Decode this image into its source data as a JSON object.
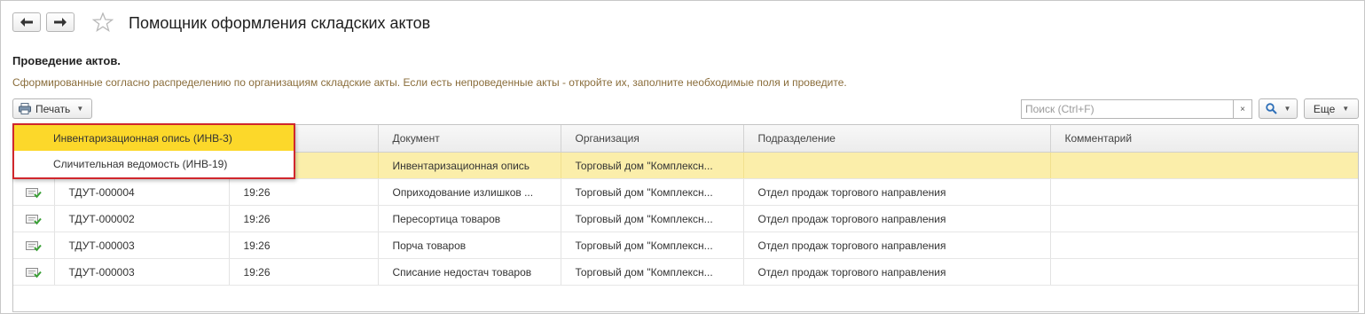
{
  "window": {
    "title": "Помощник оформления складских актов"
  },
  "section": {
    "title": "Проведение актов.",
    "hint": "Сформированные согласно распределению по организациям складские акты. Если есть непроведенные акты - откройте их, заполните необходимые поля и проведите."
  },
  "toolbar": {
    "print_label": "Печать",
    "search_placeholder": "Поиск (Ctrl+F)",
    "clear_label": "×",
    "more_label": "Еще"
  },
  "dropdown": {
    "items": [
      {
        "label": "Инвентаризационная опись (ИНВ-3)",
        "active": true
      },
      {
        "label": "Сличительная ведомость (ИНВ-19)",
        "active": false
      }
    ]
  },
  "table": {
    "columns": [
      "",
      "",
      "",
      "Документ",
      "Организация",
      "Подразделение",
      "Комментарий"
    ],
    "rows": [
      {
        "number": "",
        "time": "",
        "document": "Инвентаризационная опись",
        "organization": "Торговый дом \"Комплексн...",
        "department": "",
        "comment": "",
        "selected": true
      },
      {
        "number": "ТДУТ-000004",
        "time": "19:26",
        "document": "Оприходование излишков ...",
        "organization": "Торговый дом \"Комплексн...",
        "department": "Отдел продаж торгового направления",
        "comment": "",
        "selected": false
      },
      {
        "number": "ТДУТ-000002",
        "time": "19:26",
        "document": "Пересортица товаров",
        "organization": "Торговый дом \"Комплексн...",
        "department": "Отдел продаж торгового направления",
        "comment": "",
        "selected": false
      },
      {
        "number": "ТДУТ-000003",
        "time": "19:26",
        "document": "Порча товаров",
        "organization": "Торговый дом \"Комплексн...",
        "department": "Отдел продаж торгового направления",
        "comment": "",
        "selected": false
      },
      {
        "number": "ТДУТ-000003",
        "time": "19:26",
        "document": "Списание недостач товаров",
        "organization": "Торговый дом \"Комплексн...",
        "department": "Отдел продаж торгового направления",
        "comment": "",
        "selected": false
      }
    ]
  },
  "colors": {
    "selected_row": "#fbeeaa",
    "menu_highlight": "#fcd82a",
    "menu_border": "#d0272d",
    "hint_text": "#8a6d3b"
  }
}
